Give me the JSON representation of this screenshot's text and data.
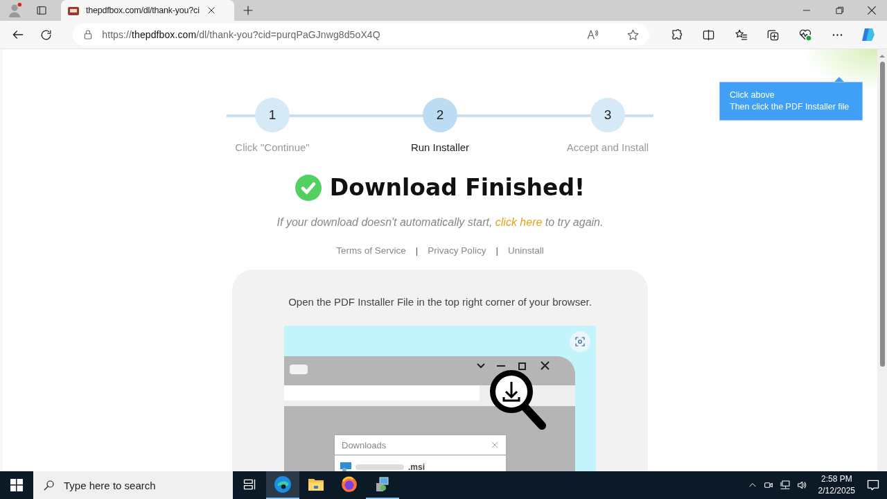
{
  "browser": {
    "tab_title": "thepdfbox.com/dl/thank-you?ci",
    "url_scheme": "https://",
    "url_host": "thepdfbox.com",
    "url_path": "/dl/thank-you?cid=purqPaGJnwg8d5oX4Q"
  },
  "tooltip": {
    "lines": [
      "Click above",
      "Then click the PDF Installer file"
    ]
  },
  "steps": [
    {
      "number": "1",
      "label": "Click \"Continue\"",
      "selected": false
    },
    {
      "number": "2",
      "label": "Run Installer",
      "selected": true
    },
    {
      "number": "3",
      "label": "Accept and Install",
      "selected": false
    }
  ],
  "heading": "Download Finished!",
  "retry": {
    "before": "If your download doesn't automatically start, ",
    "link": "click here",
    "after": " to try again."
  },
  "links": [
    {
      "kind": "link",
      "text": "Terms of Service"
    },
    {
      "kind": "separator",
      "text": "|"
    },
    {
      "kind": "link",
      "text": "Privacy Policy"
    },
    {
      "kind": "separator",
      "text": "|"
    },
    {
      "kind": "link",
      "text": "Uninstall"
    }
  ],
  "card": {
    "instruction": "Open the PDF Installer File in the top right corner of your browser.",
    "illustration": {
      "panel_title": "Downloads",
      "file_name": ".msi"
    }
  },
  "taskbar": {
    "search_placeholder": "Type here to search",
    "apps": [
      {
        "kind": "task-view",
        "selected": false,
        "running": false
      },
      {
        "kind": "edge",
        "selected": true,
        "running": true
      },
      {
        "kind": "files",
        "selected": false,
        "running": false
      },
      {
        "kind": "firefox",
        "selected": false,
        "running": false
      },
      {
        "kind": "installer",
        "selected": false,
        "running": true
      }
    ],
    "time": "2:58 PM",
    "date": "2/12/2025"
  }
}
